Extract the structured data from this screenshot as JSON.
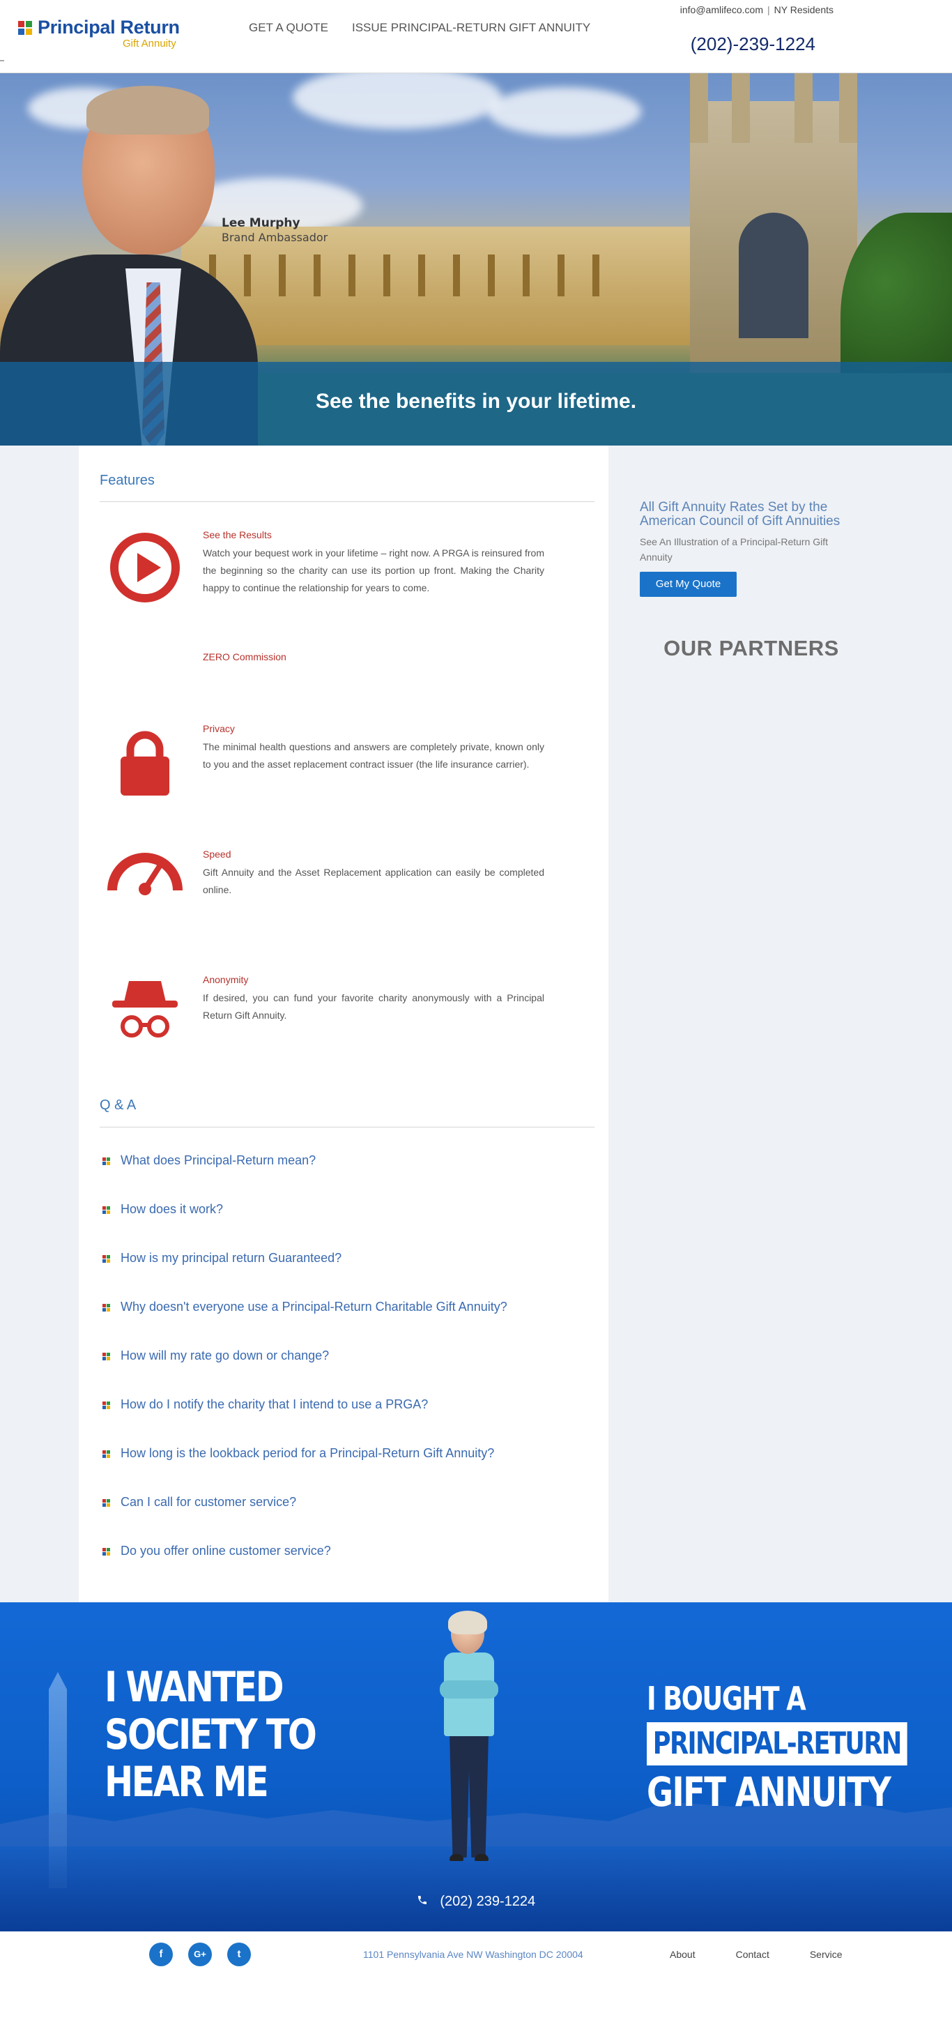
{
  "header": {
    "logo_title": "Principal Return",
    "logo_subtitle": "Gift Annuity",
    "nav": [
      "GET A QUOTE",
      "ISSUE PRINCIPAL-RETURN GIFT ANNUITY"
    ],
    "email": "info@amlifeco.com",
    "residents_link": "NY Residents",
    "phone": "(202)-239-1224"
  },
  "hero": {
    "person_name": "Lee Murphy",
    "person_role": "Brand Ambassador",
    "tagline": "See the benefits in your lifetime."
  },
  "features": {
    "title": "Features",
    "items": [
      {
        "icon": "play-circle-icon",
        "title": "See the Results",
        "desc": "Watch your bequest work in your lifetime – right now. A PRGA is reinsured from the beginning so the charity can use its portion up front. Making the Charity happy to continue the relationship for years to come."
      },
      {
        "icon": "none",
        "title": "ZERO Commission",
        "desc": ""
      },
      {
        "icon": "lock-icon",
        "title": "Privacy",
        "desc": "The minimal health questions and answers are completely private, known only to you and the asset replacement contract issuer (the life insurance carrier)."
      },
      {
        "icon": "speedometer-icon",
        "title": "Speed",
        "desc": "Gift Annuity and the Asset Replacement application can easily be completed online."
      },
      {
        "icon": "incognito-icon",
        "title": "Anonymity",
        "desc": "If desired, you can fund your favorite charity anonymously with a Principal Return Gift Annuity."
      }
    ]
  },
  "qa": {
    "title": "Q & A",
    "items": [
      "What does Principal-Return mean?",
      "How does it work?",
      "How is my principal return Guaranteed?",
      "Why doesn't everyone use a Principal-Return Charitable Gift Annuity?",
      "How will my rate go down or change?",
      "How do I notify the charity that I intend to use a PRGA?",
      "How long is the lookback period for a Principal-Return Gift Annuity?",
      "Can I call for customer service?",
      "Do you offer online customer service?"
    ]
  },
  "sidebar": {
    "rates_title": "All Gift Annuity Rates Set by the American Council of Gift Annuities",
    "rates_sub": "See An Illustration of a Principal-Return Gift Annuity",
    "quote_button": "Get My Quote",
    "partners_heading": "OUR PARTNERS"
  },
  "banner": {
    "left_lines": [
      "I WANTED",
      "SOCIETY TO",
      "HEAR ME"
    ],
    "right_line1": "I BOUGHT A",
    "right_line2": "PRINCIPAL-RETURN",
    "right_line3": "GIFT ANNUITY",
    "phone": "(202) 239-1224"
  },
  "footer": {
    "social": [
      {
        "name": "facebook-icon",
        "glyph": "f"
      },
      {
        "name": "google-plus-icon",
        "glyph": "G+"
      },
      {
        "name": "twitter-icon",
        "glyph": "t"
      }
    ],
    "address": "1101 Pennsylvania Ave NW Washington DC 20004",
    "links": [
      "About",
      "Contact",
      "Service"
    ]
  },
  "colors": {
    "brand_blue": "#1a4fa3",
    "accent_red": "#d0312d",
    "button_blue": "#1a73c9",
    "banner_blue": "#0d5ec8"
  }
}
